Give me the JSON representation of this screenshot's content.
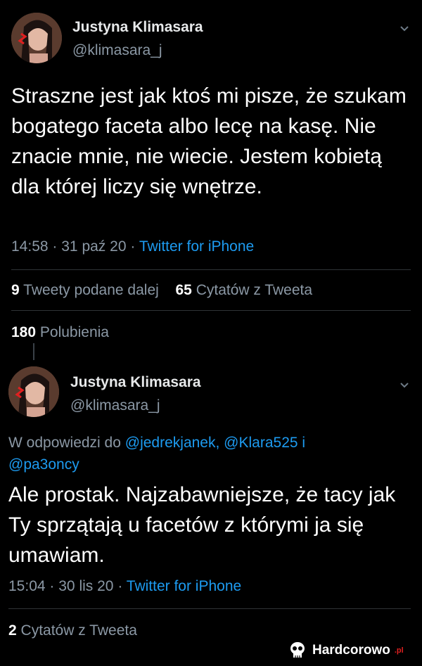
{
  "tweet1": {
    "author_name": "Justyna Klimasara",
    "author_handle": "@klimasara_j",
    "menu_icon": "chevron-down-icon",
    "text": "Straszne jest jak ktoś mi pisze, że szukam bogatego faceta albo lecę na kasę. Nie znacie mnie, nie wiecie. Jestem kobietą dla której liczy się wnętrze.",
    "time": "14:58",
    "date": "31 paź 20",
    "dot": "·",
    "source": "Twitter for iPhone",
    "retweets_count": "9",
    "retweets_label": "Tweety podane dalej",
    "quotes_count": "65",
    "quotes_label": "Cytatów z Tweeta",
    "likes_count": "180",
    "likes_label": "Polubienia"
  },
  "tweet2": {
    "author_name": "Justyna Klimasara",
    "author_handle": "@klimasara_j",
    "menu_icon": "chevron-down-icon",
    "reply_prefix": "W odpowiedzi do",
    "reply_mention_1": "@jedrekjanek,",
    "reply_mention_2": "@Klara525",
    "reply_and": "i",
    "reply_mention_3": "@pa3oncy",
    "text": "Ale prostak. Najzabawniejsze, że tacy jak Ty sprzątają u facetów z którymi ja się umawiam.",
    "time": "15:04",
    "date": "30 lis 20",
    "dot": "·",
    "source": "Twitter for iPhone",
    "quotes_count": "2",
    "quotes_label": "Cytatów z Tweeta"
  },
  "watermark": {
    "brand": "Hardcorowo",
    "suffix": ".pl",
    "icon": "skull-icon"
  },
  "colors": {
    "background": "#000000",
    "link": "#1d9bf0",
    "muted": "#8b98a5",
    "separator": "#2f3336"
  }
}
